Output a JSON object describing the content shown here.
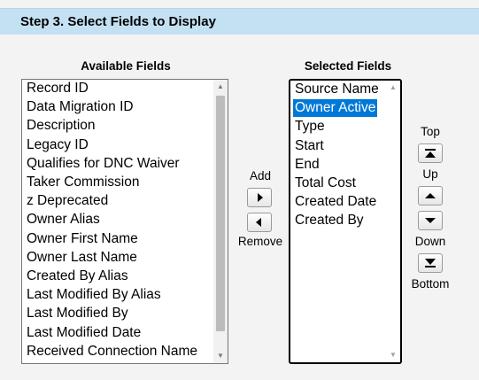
{
  "header": {
    "title": "Step 3. Select Fields to Display"
  },
  "available": {
    "label": "Available Fields",
    "items": [
      "Record ID",
      "Data Migration ID",
      "Description",
      "Legacy ID",
      "Qualifies for DNC Waiver",
      "Taker Commission",
      "z Deprecated",
      "Owner Alias",
      "Owner First Name",
      "Owner Last Name",
      "Created By Alias",
      "Last Modified By Alias",
      "Last Modified By",
      "Last Modified Date",
      "Received Connection Name"
    ]
  },
  "selected": {
    "label": "Selected Fields",
    "items": [
      "Source Name",
      "Owner Active",
      "Type",
      "Start",
      "End",
      "Total Cost",
      "Created Date",
      "Created By"
    ],
    "highlighted_item": "Owner Active"
  },
  "transfer": {
    "add_label": "Add",
    "remove_label": "Remove"
  },
  "order": {
    "top_label": "Top",
    "up_label": "Up",
    "down_label": "Down",
    "bottom_label": "Bottom"
  },
  "colors": {
    "header_bg": "#c4e1f4",
    "selection": "#0078d7",
    "page_bg": "#f3f3f3"
  },
  "icons": {
    "add": "triangle-right-icon",
    "remove": "triangle-left-icon",
    "top": "move-top-icon",
    "up": "triangle-up-icon",
    "down": "triangle-down-icon",
    "bottom": "move-bottom-icon"
  }
}
